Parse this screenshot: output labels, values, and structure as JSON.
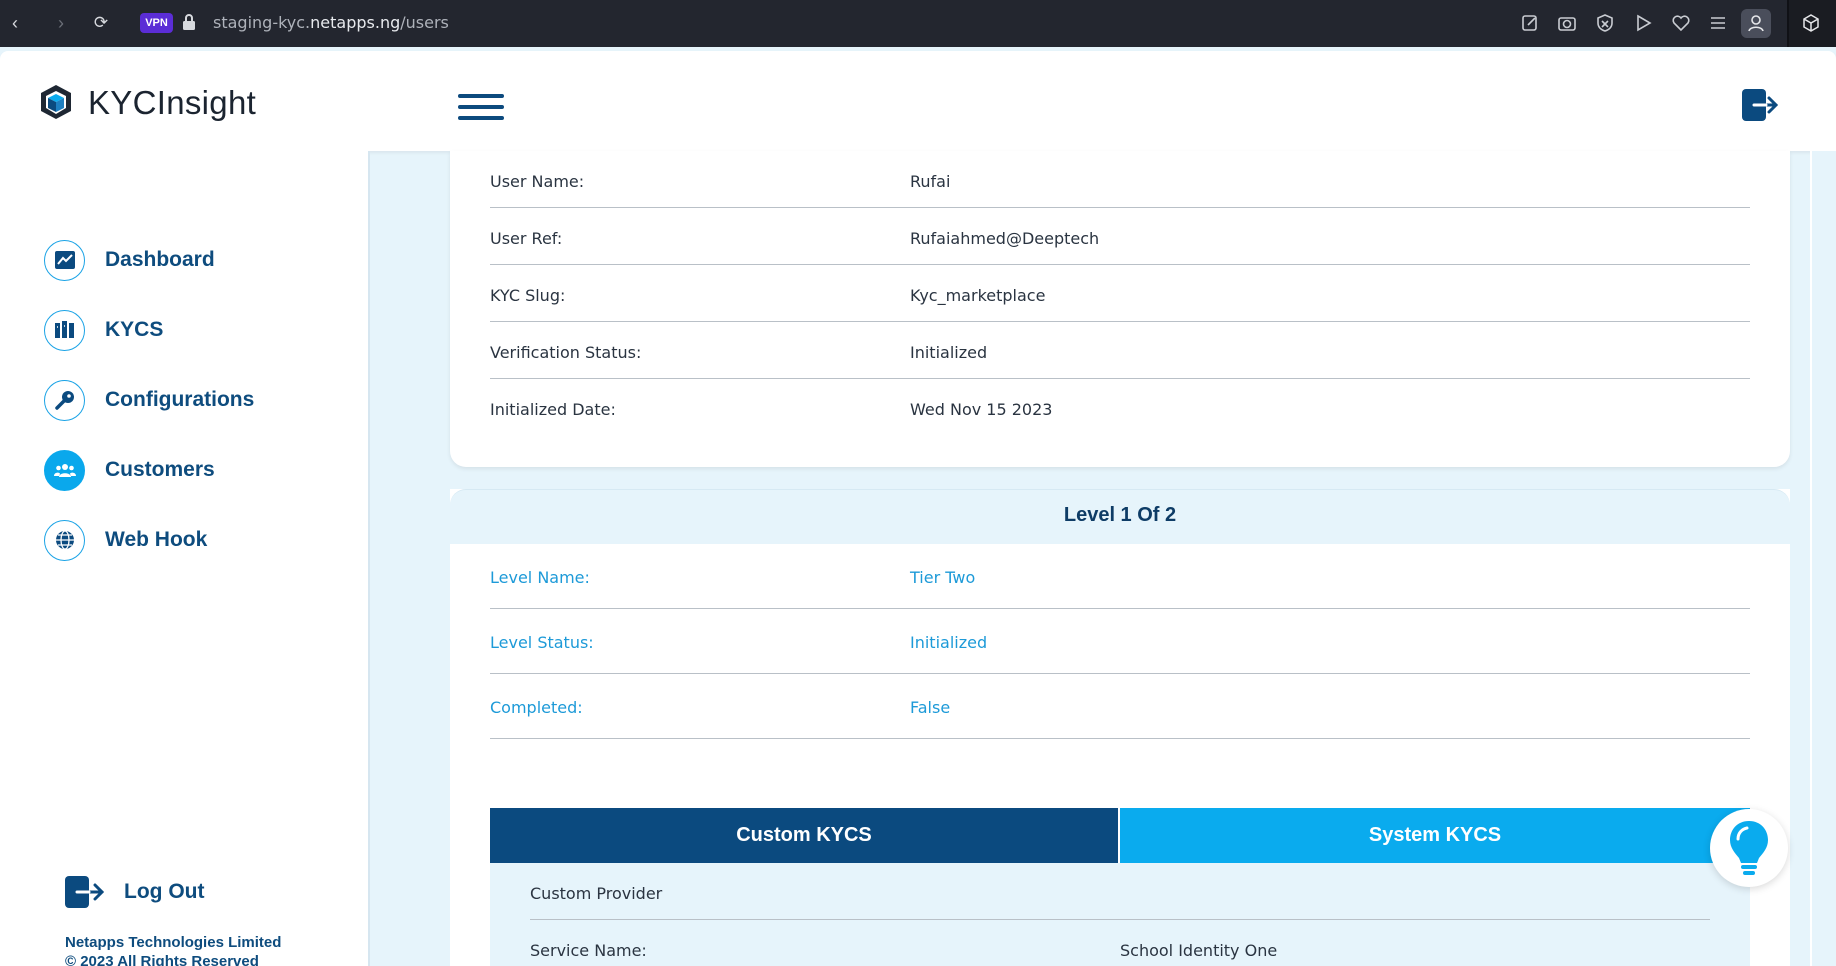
{
  "browser": {
    "vpn_label": "VPN",
    "url_prefix": "staging-kyc.",
    "url_domain": "netapps.ng",
    "url_path": "/users"
  },
  "header": {
    "app_name": "KYCInsight"
  },
  "sidebar": {
    "items": [
      {
        "label": "Dashboard",
        "icon": "chart-icon"
      },
      {
        "label": "KYCS",
        "icon": "kyc-icon"
      },
      {
        "label": "Configurations",
        "icon": "key-icon"
      },
      {
        "label": "Customers",
        "icon": "users-icon",
        "active": true
      },
      {
        "label": "Web Hook",
        "icon": "globe-icon"
      }
    ],
    "logout_label": "Log Out",
    "company_line1": "Netapps Technologies Limited",
    "company_line2": "© 2023 All Rights Reserved"
  },
  "user_details": {
    "rows": [
      {
        "label": "User Name:",
        "value": "Rufai"
      },
      {
        "label": "User Ref:",
        "value": "Rufaiahmed@Deeptech"
      },
      {
        "label": "KYC Slug:",
        "value": "Kyc_marketplace"
      },
      {
        "label": "Verification Status:",
        "value": "Initialized"
      },
      {
        "label": "Initialized Date:",
        "value": "Wed Nov 15 2023"
      }
    ]
  },
  "level": {
    "title": "Level 1 Of 2",
    "rows": [
      {
        "label": "Level Name:",
        "value": "Tier Two"
      },
      {
        "label": "Level Status:",
        "value": "Initialized"
      },
      {
        "label": "Completed:",
        "value": "False"
      }
    ],
    "tabs": {
      "custom": "Custom KYCS",
      "system": "System KYCS"
    },
    "provider": {
      "heading": "Custom Provider",
      "service_label": "Service Name:",
      "service_value": "School Identity One"
    }
  },
  "colors": {
    "primary": "#0b4a7f",
    "accent": "#0aabee",
    "background": "#e6f4fb"
  }
}
